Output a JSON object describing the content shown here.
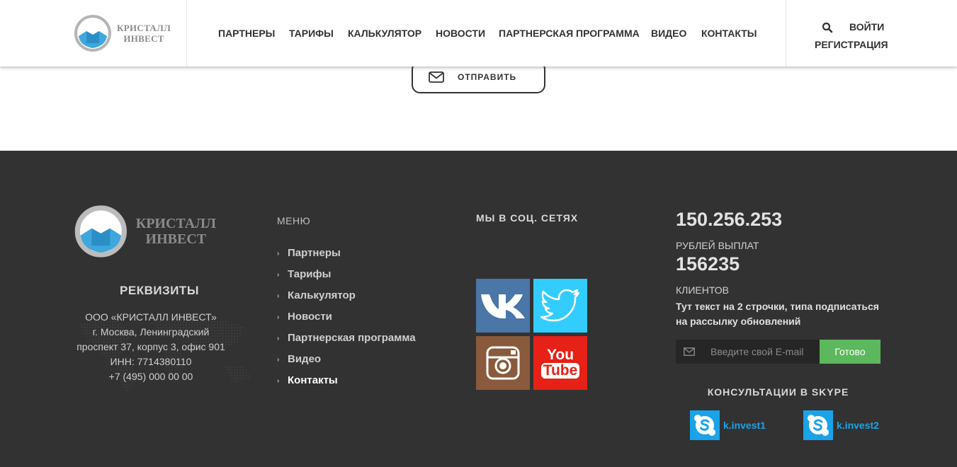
{
  "header": {
    "logo_line1": "КРИСТАЛЛ",
    "logo_line2": "ИНВЕСТ",
    "nav": [
      "ПАРТНЕРЫ",
      "ТАРИФЫ",
      "КАЛЬКУЛЯТОР",
      "НОВОСТИ",
      "ПАРТНЕРСКАЯ ПРОГРАММА",
      "ВИДЕО",
      "КОНТАКТЫ"
    ],
    "login": "ВОЙТИ",
    "register": "РЕГИСТРАЦИЯ"
  },
  "form": {
    "send_label": "ОТПРАВИТЬ"
  },
  "footer": {
    "logo_line1": "КРИСТАЛЛ",
    "logo_line2": "ИНВЕСТ",
    "requisites": {
      "title": "РЕКВИЗИТЫ",
      "lines": [
        "ООО «КРИСТАЛЛ ИНВЕСТ»",
        "г. Москва, Ленинградский",
        "проспект 37, корпус 3, офис 901",
        "ИНН: 7714380110",
        "+7 (495) 000 00 00"
      ]
    },
    "menu": {
      "title": "МЕНЮ",
      "items": [
        "Партнеры",
        "Тарифы",
        "Калькулятор",
        "Новости",
        "Партнерская программа",
        "Видео",
        "Контакты"
      ],
      "active": "Контакты"
    },
    "social": {
      "title": "МЫ В СОЦ. СЕТЯХ",
      "items": [
        {
          "name": "vk-icon",
          "color": "#4a76a8"
        },
        {
          "name": "twitter-icon",
          "color": "#33ccff"
        },
        {
          "name": "instagram-icon",
          "color": "#8a5a3c"
        },
        {
          "name": "youtube-icon",
          "color": "#e62117"
        }
      ],
      "youtube_you": "You",
      "youtube_tube": "Tube"
    },
    "stats": {
      "payout_value": "150.256.253",
      "payout_label": "РУБЛЕЙ ВЫПЛАТ",
      "clients_value": "156235",
      "clients_label": "КЛИЕНТОВ"
    },
    "subscribe": {
      "text": "Тут текст на 2 строчки, типа подписаться на рассылку обновлений",
      "placeholder": "Введите свой E-mail",
      "button": "Готово",
      "button_color": "#5cb85c"
    },
    "skype": {
      "title": "КОНСУЛЬТАЦИИ В SKYPE",
      "accounts": [
        "k.invest1",
        "k.invest2"
      ],
      "color": "#1aa3e8"
    }
  }
}
